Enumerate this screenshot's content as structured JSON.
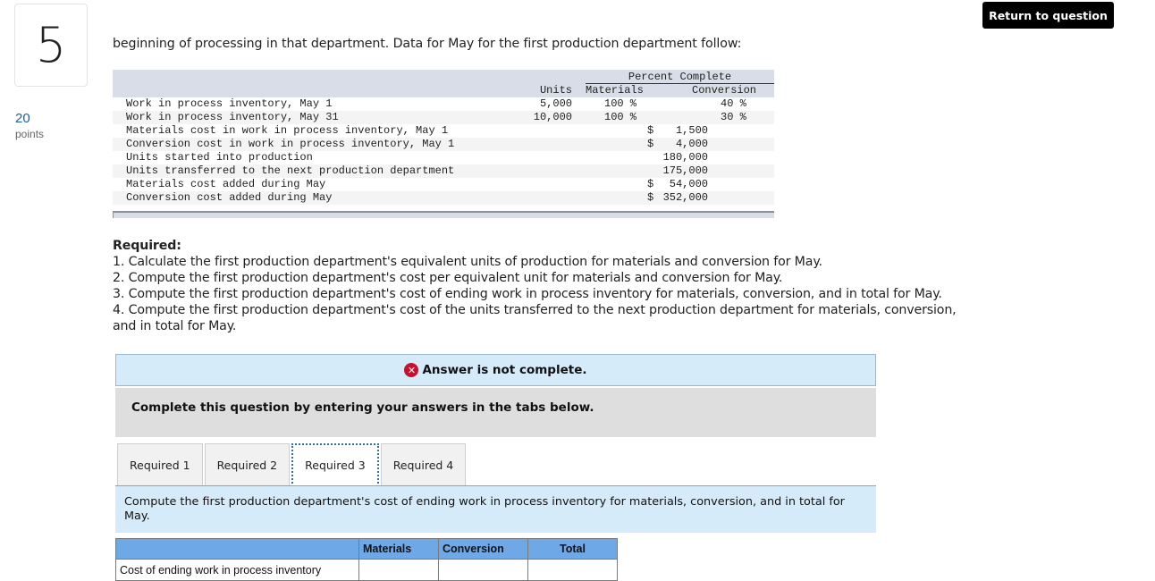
{
  "question": {
    "number": "5",
    "points_value": "20",
    "points_label": "points"
  },
  "header": {
    "return_button": "Return to question"
  },
  "intro_text": "beginning of processing in that department. Data for May for the first production department follow:",
  "data_table": {
    "group_header": "Percent Complete",
    "col_units": "Units",
    "col_materials": "Materials",
    "col_conversion": "Conversion",
    "unit_rows": [
      {
        "label": "Work in process inventory, May 1",
        "units": "5,000",
        "materials": "100 %",
        "conversion": "40 %"
      },
      {
        "label": "Work in process inventory, May 31",
        "units": "10,000",
        "materials": "100 %",
        "conversion": "30 %"
      }
    ],
    "amount_rows": [
      {
        "label": "Materials cost in work in process inventory, May 1",
        "currency": "$",
        "amount": "1,500"
      },
      {
        "label": "Conversion cost in work in process inventory, May 1",
        "currency": "$",
        "amount": "4,000"
      },
      {
        "label": "Units started into production",
        "currency": "",
        "amount": "180,000"
      },
      {
        "label": "Units transferred to the next production department",
        "currency": "",
        "amount": "175,000"
      },
      {
        "label": "Materials cost added during May",
        "currency": "$",
        "amount": "54,000"
      },
      {
        "label": "Conversion cost added during May",
        "currency": "$",
        "amount": "352,000"
      }
    ]
  },
  "required": {
    "title": "Required:",
    "items": [
      "1. Calculate the first production department's equivalent units of production for materials and conversion for May.",
      "2. Compute the first production department's cost per equivalent unit for materials and conversion for May.",
      "3. Compute the first production department's cost of ending work in process inventory for materials, conversion, and in total for May.",
      "4. Compute the first production department's cost of the units transferred to the next production department for materials, conversion, and in total for May."
    ]
  },
  "status": {
    "icon": "x-circle-icon",
    "message": "Answer is not complete.",
    "color": "#c8102e"
  },
  "instruction": "Complete this question by entering your answers in the tabs below.",
  "tabs": [
    {
      "label": "Required 1",
      "active": false
    },
    {
      "label": "Required 2",
      "active": false
    },
    {
      "label": "Required 3",
      "active": true
    },
    {
      "label": "Required 4",
      "active": false
    }
  ],
  "tab_panel": {
    "prompt": "Compute the first production department's cost of ending work in process inventory for materials, conversion, and in total for May."
  },
  "answer_table": {
    "columns": [
      "",
      "Materials",
      "Conversion",
      "Total"
    ],
    "rows": [
      {
        "label": "Cost of ending work in process inventory",
        "materials": "",
        "conversion": "",
        "total": ""
      }
    ]
  }
}
